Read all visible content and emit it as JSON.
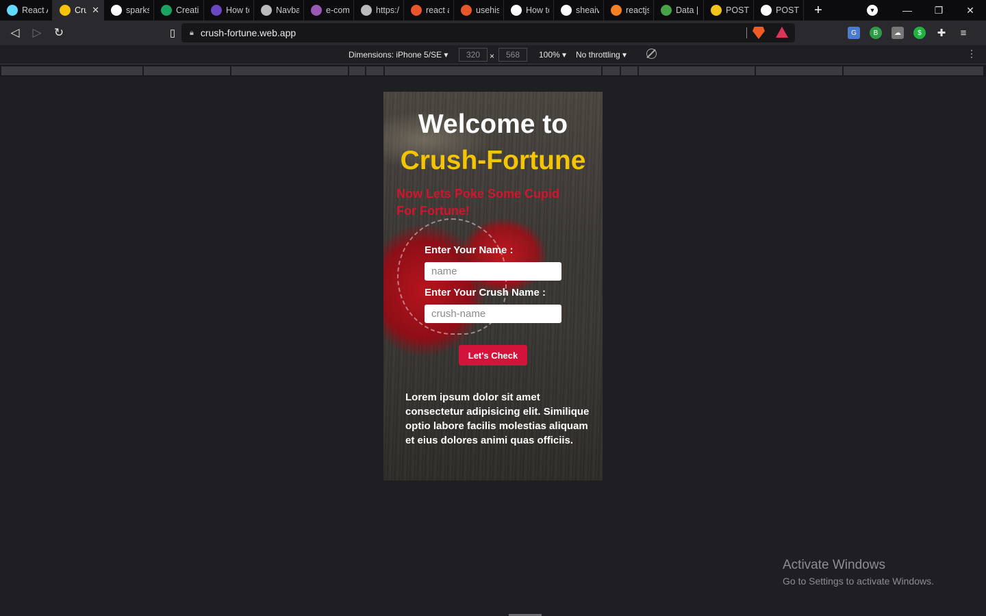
{
  "tabs": [
    {
      "label": "React A",
      "color": "#61dafb",
      "active": false,
      "close": ""
    },
    {
      "label": "Cru",
      "color": "#f5c400",
      "active": true,
      "close": "✕"
    },
    {
      "label": "sparks-",
      "color": "#ffffff",
      "active": false,
      "close": ""
    },
    {
      "label": "Creatin",
      "color": "#1aa260",
      "active": false,
      "close": ""
    },
    {
      "label": "How to",
      "color": "#6b46c1",
      "active": false,
      "close": ""
    },
    {
      "label": "Navbar",
      "color": "#bbbbbb",
      "active": false,
      "close": ""
    },
    {
      "label": "e-com",
      "color": "#9b59b6",
      "active": false,
      "close": ""
    },
    {
      "label": "https://",
      "color": "#bbbbbb",
      "active": false,
      "close": ""
    },
    {
      "label": "react a",
      "color": "#e8572b",
      "active": false,
      "close": ""
    },
    {
      "label": "usehist",
      "color": "#e8572b",
      "active": false,
      "close": ""
    },
    {
      "label": "How to",
      "color": "#ffffff",
      "active": false,
      "close": ""
    },
    {
      "label": "sheaive",
      "color": "#ffffff",
      "active": false,
      "close": ""
    },
    {
      "label": "reactjs",
      "color": "#f48024",
      "active": false,
      "close": ""
    },
    {
      "label": "Data |",
      "color": "#47a248",
      "active": false,
      "close": ""
    },
    {
      "label": "POST F",
      "color": "#f0c419",
      "active": false,
      "close": ""
    },
    {
      "label": "POST F",
      "color": "#ffffff",
      "active": false,
      "close": ""
    }
  ],
  "toolbar": {
    "url": "crush-fortune.web.app"
  },
  "devtools": {
    "dimensions_label": "Dimensions: iPhone 5/SE",
    "width": "320",
    "height": "568",
    "times": "×",
    "zoom": "100%",
    "throttling": "No throttling"
  },
  "app": {
    "welcome": "Welcome to",
    "brand": "Crush-Fortune",
    "tagline": "Now Lets Poke Some Cupid For Fortune!",
    "name_label": "Enter Your Name :",
    "name_placeholder": "name",
    "crush_label": "Enter Your Crush Name :",
    "crush_placeholder": "crush-name",
    "button": "Let's Check",
    "lorem": "Lorem ipsum dolor sit amet consectetur adipisicing elit. Similique optio labore facilis molestias aliquam et eius dolores animi quas officiis.",
    "colors": {
      "brand": "#f5c400",
      "tagline": "#d2142e",
      "button": "#d2143a"
    }
  },
  "os": {
    "activate_title": "Activate Windows",
    "activate_sub": "Go to Settings to activate Windows."
  }
}
